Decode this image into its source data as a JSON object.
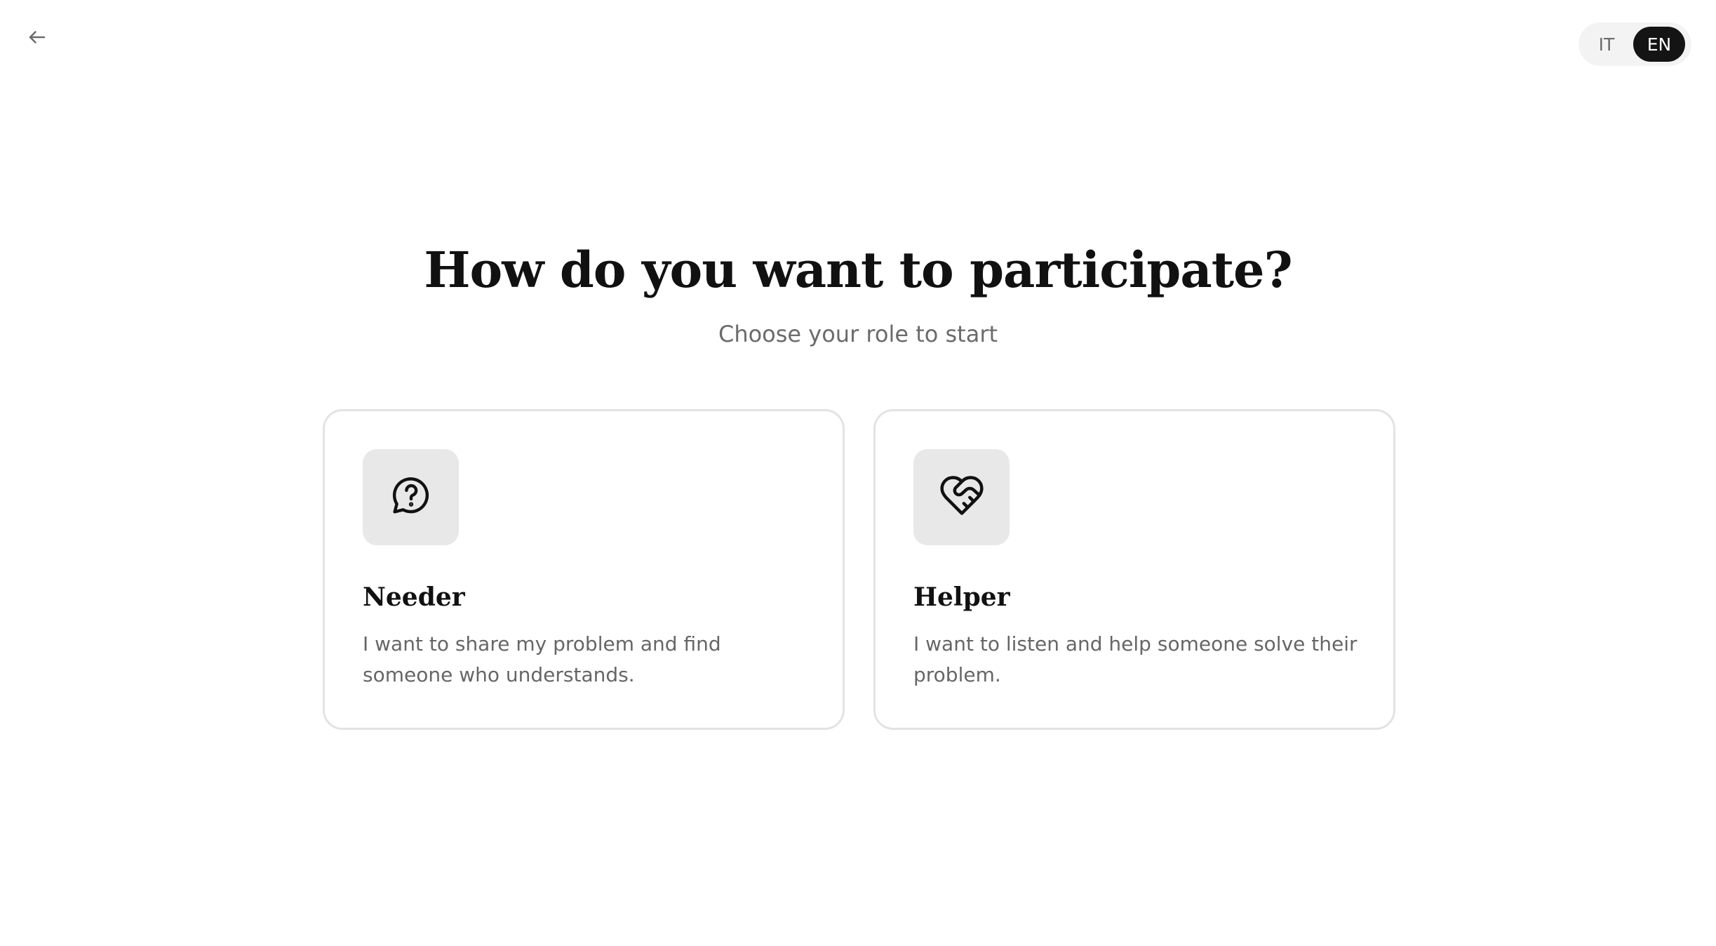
{
  "nav": {
    "back_icon": "arrow-left-icon"
  },
  "language": {
    "options": [
      "IT",
      "EN"
    ],
    "selected": "EN"
  },
  "main": {
    "title": "How do you want to participate?",
    "subtitle": "Choose your role to start"
  },
  "roles": [
    {
      "icon": "question-chat-icon",
      "title": "Needer",
      "description": "I want to share my problem and find someone who understands."
    },
    {
      "icon": "heart-handshake-icon",
      "title": "Helper",
      "description": "I want to listen and help someone solve their problem."
    }
  ],
  "colors": {
    "text": "#111111",
    "muted": "#6b6b6b",
    "card_border": "#e3e3e3",
    "icon_bg": "#e8e8e8",
    "toggle_bg": "#f3f3f3",
    "toggle_active": "#141414"
  }
}
